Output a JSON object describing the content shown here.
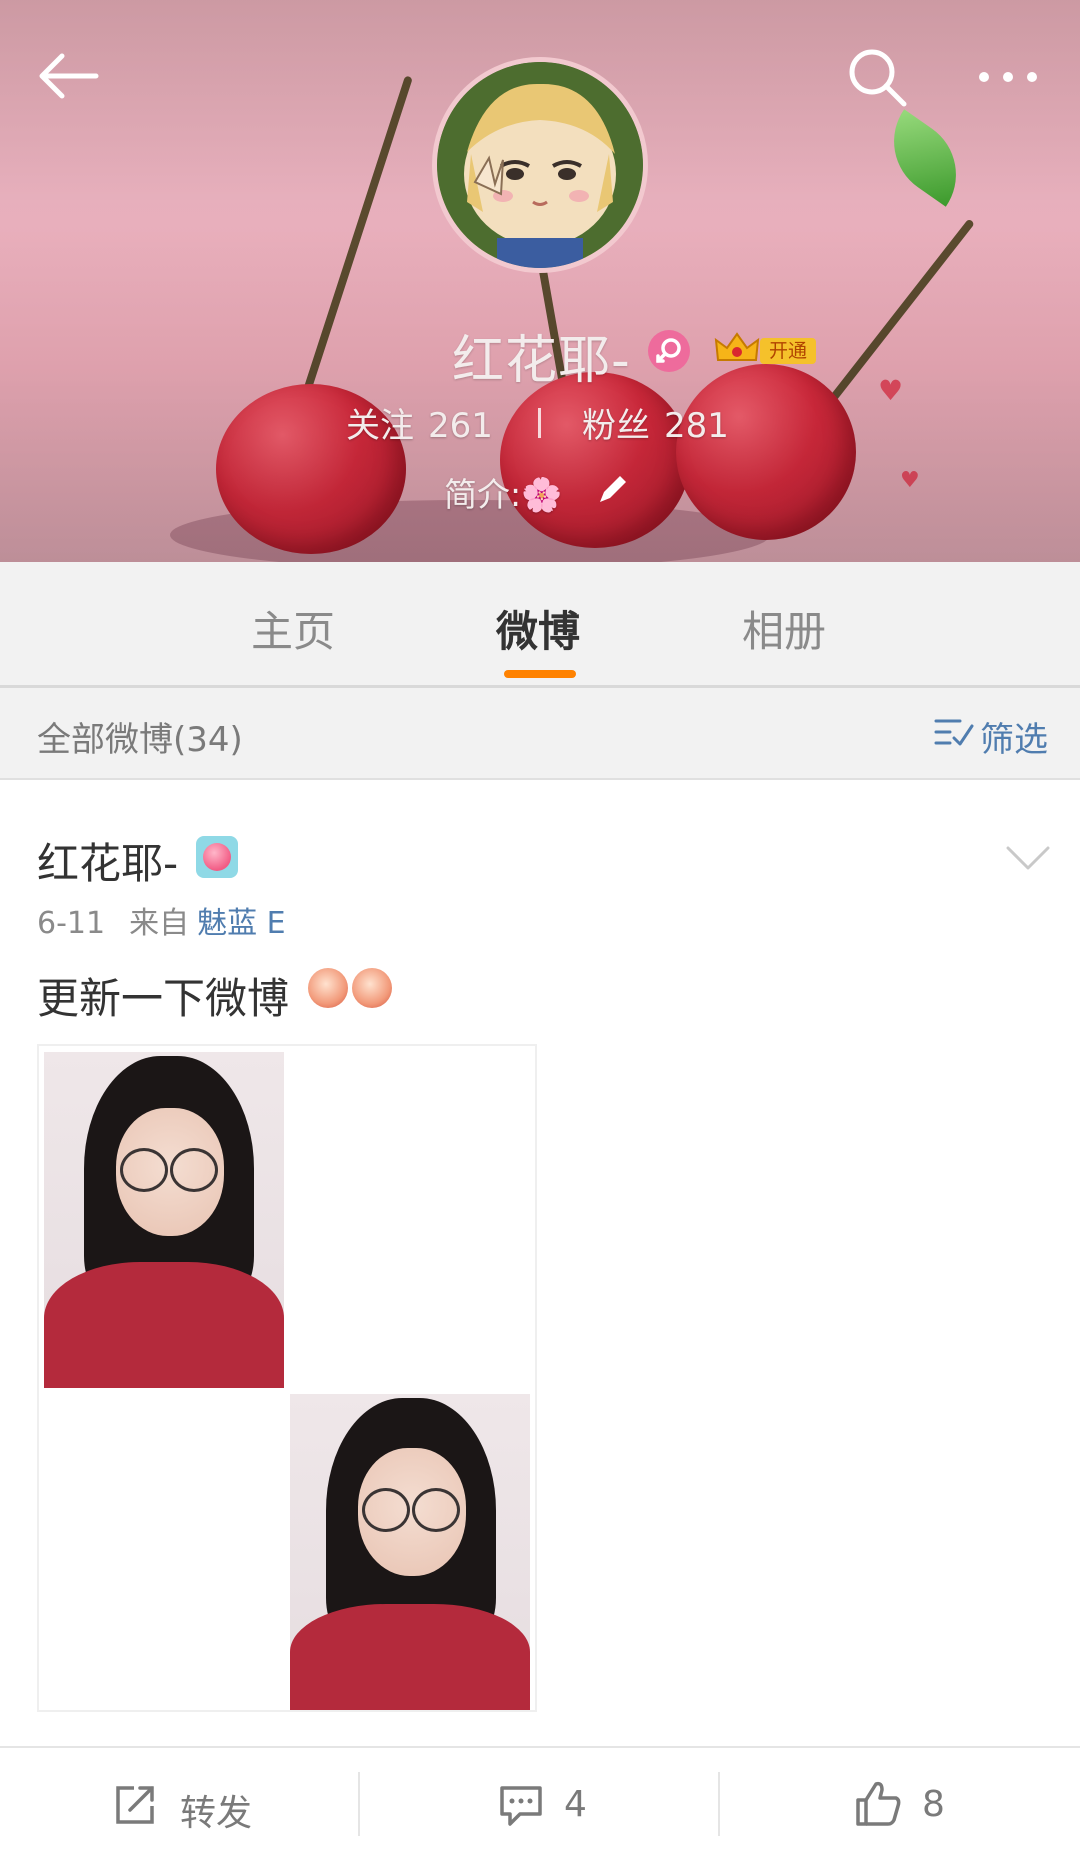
{
  "header": {
    "username": "红花耶-",
    "vip_label": "开通",
    "following_label": "关注",
    "following_count": "261",
    "stat_separator": "|",
    "followers_label": "粉丝",
    "followers_count": "281",
    "bio_label": "简介:🌸"
  },
  "tabs": [
    {
      "label": "主页",
      "active": false
    },
    {
      "label": "微博",
      "active": true
    },
    {
      "label": "相册",
      "active": false
    }
  ],
  "filter": {
    "count_label": "全部微博(34)",
    "button_label": "筛选"
  },
  "post": {
    "author": "红花耶-",
    "date": "6-11",
    "from_label": "来自",
    "source": "魅蓝 E",
    "text": "更新一下微博"
  },
  "actions": {
    "repost_label": "转发",
    "comment_count": "4",
    "like_count": "8"
  },
  "colors": {
    "accent_orange": "#ff8200",
    "link_blue": "#507daf",
    "header_pink": "#e8b0bd"
  }
}
